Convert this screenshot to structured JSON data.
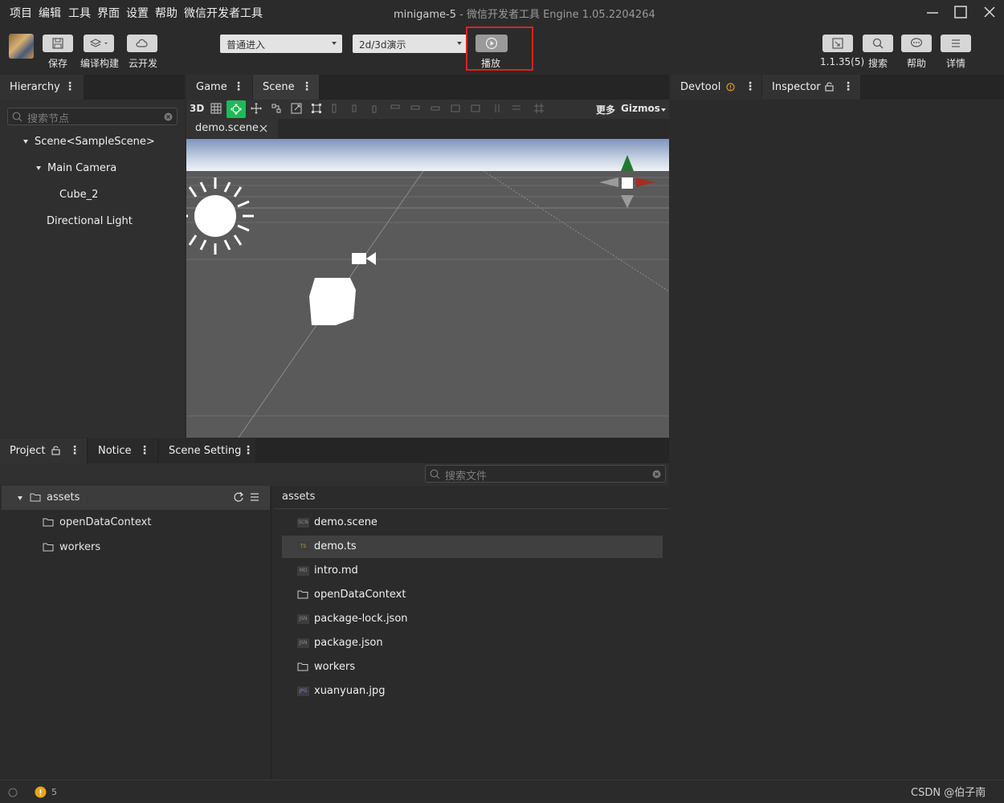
{
  "menu": [
    "项目",
    "编辑",
    "工具",
    "界面",
    "设置",
    "帮助",
    "微信开发者工具"
  ],
  "window": {
    "project": "minigame-5",
    "separator": " - ",
    "engine": "微信开发者工具 Engine 1.05.2204264"
  },
  "toolbar": {
    "save_label": "保存",
    "build_label": "编译构建",
    "cloud_label": "云开发",
    "mode_select": "普通进入",
    "scene_select": "2d/3d演示",
    "play_label": "播放",
    "version_label": "1.1.35(5)",
    "search_label": "搜索",
    "help_label": "帮助",
    "details_label": "详情"
  },
  "hierarchy": {
    "tab": "Hierarchy",
    "search_placeholder": "搜索节点",
    "nodes": [
      "Scene<SampleScene>",
      "Main Camera",
      "Cube_2",
      "Directional Light"
    ]
  },
  "center_tabs": {
    "game": "Game",
    "scene": "Scene"
  },
  "scene_toolbar": {
    "mode_3d": "3D",
    "more_label": "更多",
    "gizmos_label": "Gizmos"
  },
  "scene_doc_tab": "demo.scene",
  "right_tabs": {
    "devtool": "Devtool",
    "inspector": "Inspector"
  },
  "bottom_tabs": {
    "project": "Project",
    "notice": "Notice",
    "scene_setting": "Scene Setting"
  },
  "project": {
    "search_placeholder": "搜索文件",
    "tree": [
      "assets",
      "openDataContext",
      "workers"
    ],
    "breadcrumb": "assets",
    "files": [
      {
        "name": "demo.scene",
        "type": "SCN"
      },
      {
        "name": "demo.ts",
        "type": "TS"
      },
      {
        "name": "intro.md",
        "type": "MD"
      },
      {
        "name": "openDataContext",
        "type": "folder"
      },
      {
        "name": "package-lock.json",
        "type": "JSN"
      },
      {
        "name": "package.json",
        "type": "JSN"
      },
      {
        "name": "workers",
        "type": "folder"
      },
      {
        "name": "xuanyuan.jpg",
        "type": "JPG"
      }
    ]
  },
  "statusbar": {
    "warning_count": "5",
    "watermark": "CSDN @伯子南"
  }
}
